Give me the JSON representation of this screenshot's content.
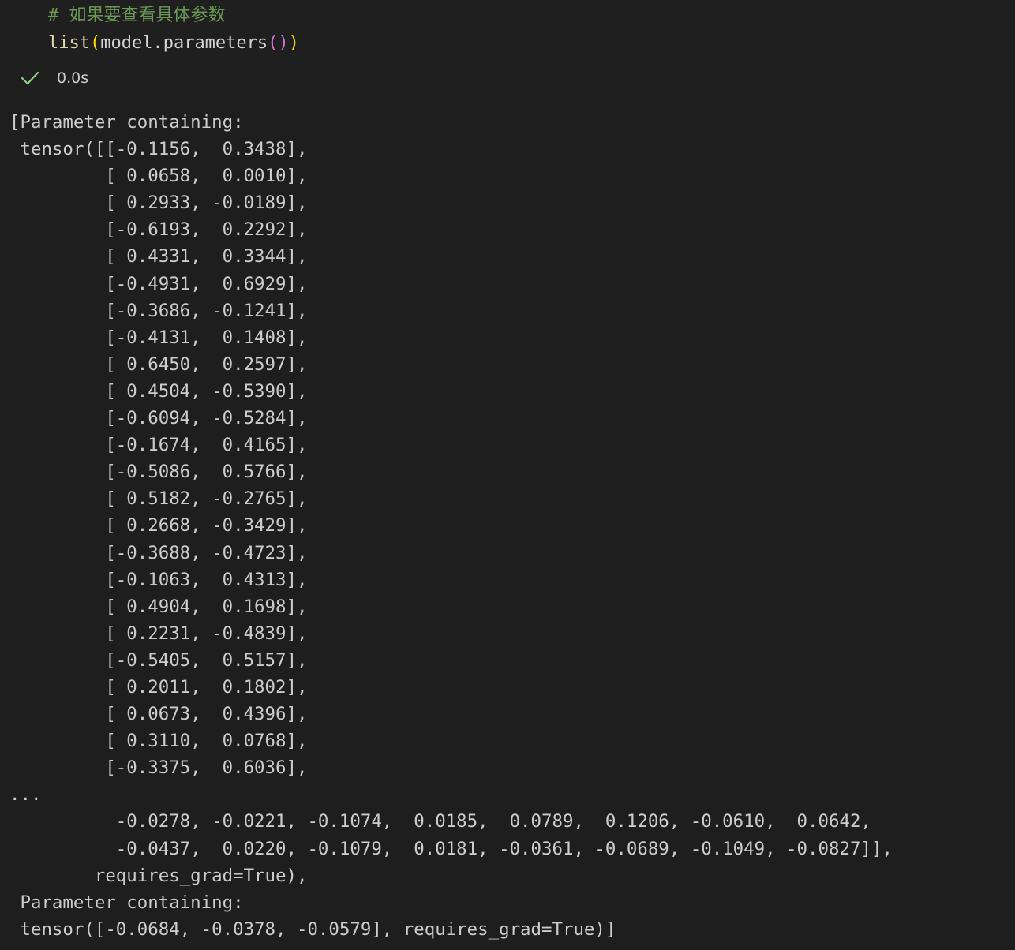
{
  "code": {
    "comment": "# 如果要查看具体参数",
    "func": "list",
    "open_paren_outer": "(",
    "call": "model.parameters",
    "inner_parens": "()",
    "close_paren_outer": ")"
  },
  "status": {
    "icon": "check-icon",
    "success_color": "#89d185",
    "exec_time": "0.0s"
  },
  "output": {
    "lines": [
      "[Parameter containing:",
      " tensor([[-0.1156,  0.3438],",
      "         [ 0.0658,  0.0010],",
      "         [ 0.2933, -0.0189],",
      "         [-0.6193,  0.2292],",
      "         [ 0.4331,  0.3344],",
      "         [-0.4931,  0.6929],",
      "         [-0.3686, -0.1241],",
      "         [-0.4131,  0.1408],",
      "         [ 0.6450,  0.2597],",
      "         [ 0.4504, -0.5390],",
      "         [-0.6094, -0.5284],",
      "         [-0.1674,  0.4165],",
      "         [-0.5086,  0.5766],",
      "         [ 0.5182, -0.2765],",
      "         [ 0.2668, -0.3429],",
      "         [-0.3688, -0.4723],",
      "         [-0.1063,  0.4313],",
      "         [ 0.4904,  0.1698],",
      "         [ 0.2231, -0.4839],",
      "         [-0.5405,  0.5157],",
      "         [ 0.2011,  0.1802],",
      "         [ 0.0673,  0.4396],",
      "         [ 0.3110,  0.0768],",
      "         [-0.3375,  0.6036],",
      "...",
      "          -0.0278, -0.0221, -0.1074,  0.0185,  0.0789,  0.1206, -0.0610,  0.0642,",
      "          -0.0437,  0.0220, -0.1079,  0.0181, -0.0361, -0.0689, -0.1049, -0.0827]],",
      "        requires_grad=True),",
      " Parameter containing:",
      " tensor([-0.0684, -0.0378, -0.0579], requires_grad=True)]"
    ]
  }
}
